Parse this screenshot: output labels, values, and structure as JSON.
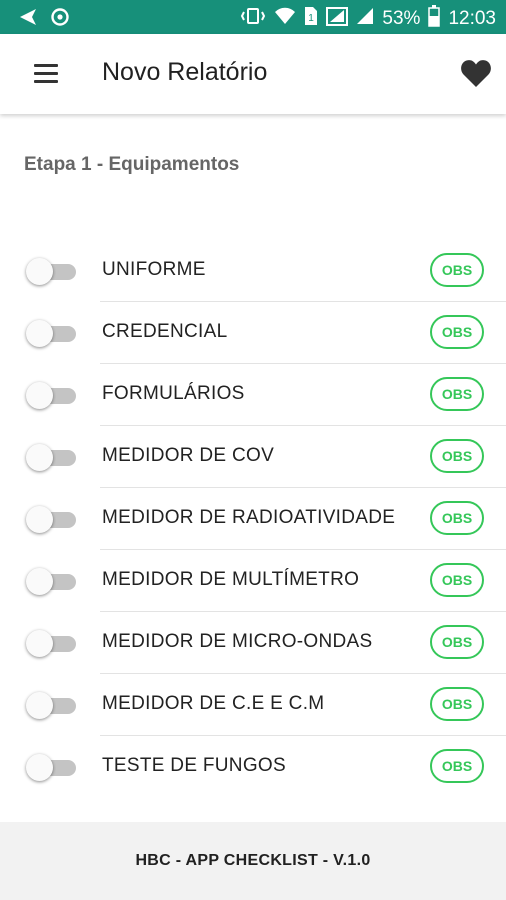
{
  "status_bar": {
    "battery_percent": "53%",
    "time": "12:03",
    "left_icons": [
      "back-arrow-icon",
      "sync-icon"
    ],
    "right_icons": [
      "vibrate-icon",
      "wifi-icon",
      "sim-icon",
      "signal-icon",
      "signal-icon",
      "battery-icon"
    ],
    "color": "#17907a"
  },
  "app_bar": {
    "title": "Novo Relatório",
    "menu_icon": "hamburger-menu-icon",
    "favorite_icon": "heart-icon"
  },
  "section": {
    "title": "Etapa 1 - Equipamentos"
  },
  "items": [
    {
      "label": "UNIFORME",
      "obs_label": "OBS",
      "enabled": false
    },
    {
      "label": "CREDENCIAL",
      "obs_label": "OBS",
      "enabled": false
    },
    {
      "label": "FORMULÁRIOS",
      "obs_label": "OBS",
      "enabled": false
    },
    {
      "label": "MEDIDOR DE COV",
      "obs_label": "OBS",
      "enabled": false
    },
    {
      "label": "MEDIDOR DE RADIOATIVIDADE",
      "obs_label": "OBS",
      "enabled": false
    },
    {
      "label": "MEDIDOR DE MULTÍMETRO",
      "obs_label": "OBS",
      "enabled": false
    },
    {
      "label": "MEDIDOR DE MICRO-ONDAS",
      "obs_label": "OBS",
      "enabled": false
    },
    {
      "label": "MEDIDOR DE C.E E C.M",
      "obs_label": "OBS",
      "enabled": false
    },
    {
      "label": "TESTE DE FUNGOS",
      "obs_label": "OBS",
      "enabled": false
    }
  ],
  "footer": {
    "text": "HBC - APP CHECKLIST - V.1.0"
  },
  "colors": {
    "accent": "#35c759",
    "status_bar": "#17907a"
  }
}
